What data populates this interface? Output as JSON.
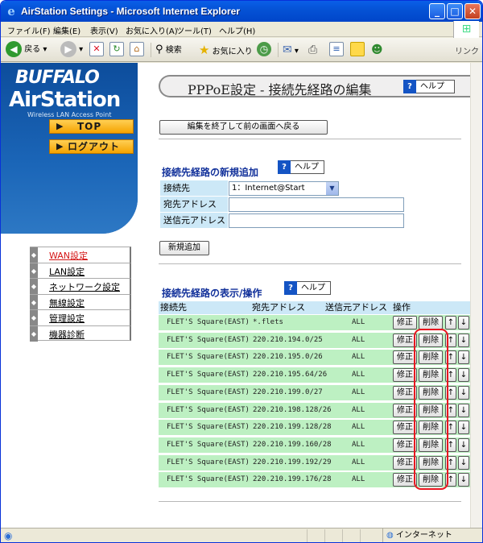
{
  "window": {
    "title": "AirStation Settings - Microsoft Internet Explorer",
    "minimize": "_",
    "maximize": "□",
    "close": "✕"
  },
  "menu": [
    "ファイル(F)",
    "編集(E)",
    "表示(V)",
    "お気に入り(A)",
    "ツール(T)",
    "ヘルプ(H)"
  ],
  "toolbar": {
    "back": "戻る",
    "search": "検索",
    "favorites": "お気に入り",
    "links": "リンク"
  },
  "status": {
    "zone": "インターネット"
  },
  "brand": {
    "logo_top": "BUFFALO",
    "logo_main": "AirStation",
    "logo_sub": "Wireless LAN Access Point",
    "top_button": "TOP",
    "logout_button": "ログアウト"
  },
  "nav": [
    {
      "label": "WAN設定",
      "active": true
    },
    {
      "label": "LAN設定",
      "active": false
    },
    {
      "label": "ネットワーク設定",
      "active": false
    },
    {
      "label": "無線設定",
      "active": false
    },
    {
      "label": "管理設定",
      "active": false
    },
    {
      "label": "機器診断",
      "active": false
    }
  ],
  "page": {
    "title": "PPPoE設定 - 接続先経路の編集",
    "help": "ヘルプ",
    "back_button": "編集を終了して前の画面へ戻る"
  },
  "add_section": {
    "title": "接続先経路の新規追加",
    "help": "ヘルプ",
    "fields": {
      "destination_label": "接続先",
      "destination_value": "1：Internet@Start",
      "dest_address_label": "宛先アドレス",
      "src_address_label": "送信元アドレス"
    },
    "add_button": "新規追加"
  },
  "list_section": {
    "title": "接続先経路の表示/操作",
    "help": "ヘルプ",
    "headers": [
      "接続先",
      "宛先アドレス",
      "送信元アドレス",
      "操作"
    ],
    "edit_label": "修正",
    "delete_label": "削除",
    "up_label": "↑",
    "down_label": "↓",
    "rows": [
      {
        "dest": "FLET'S Square(EAST)",
        "address": "*.flets",
        "source": "ALL"
      },
      {
        "dest": "FLET'S Square(EAST)",
        "address": "220.210.194.0/25",
        "source": "ALL"
      },
      {
        "dest": "FLET'S Square(EAST)",
        "address": "220.210.195.0/26",
        "source": "ALL"
      },
      {
        "dest": "FLET'S Square(EAST)",
        "address": "220.210.195.64/26",
        "source": "ALL"
      },
      {
        "dest": "FLET'S Square(EAST)",
        "address": "220.210.199.0/27",
        "source": "ALL"
      },
      {
        "dest": "FLET'S Square(EAST)",
        "address": "220.210.198.128/26",
        "source": "ALL"
      },
      {
        "dest": "FLET'S Square(EAST)",
        "address": "220.210.199.128/28",
        "source": "ALL"
      },
      {
        "dest": "FLET'S Square(EAST)",
        "address": "220.210.199.160/28",
        "source": "ALL"
      },
      {
        "dest": "FLET'S Square(EAST)",
        "address": "220.210.199.192/29",
        "source": "ALL"
      },
      {
        "dest": "FLET'S Square(EAST)",
        "address": "220.210.199.176/28",
        "source": "ALL"
      }
    ]
  },
  "colors": {
    "row_bg": "#bdf0c2",
    "label_bg": "#cce8f7",
    "highlight": "#e8171f",
    "active_nav": "#d41414"
  }
}
